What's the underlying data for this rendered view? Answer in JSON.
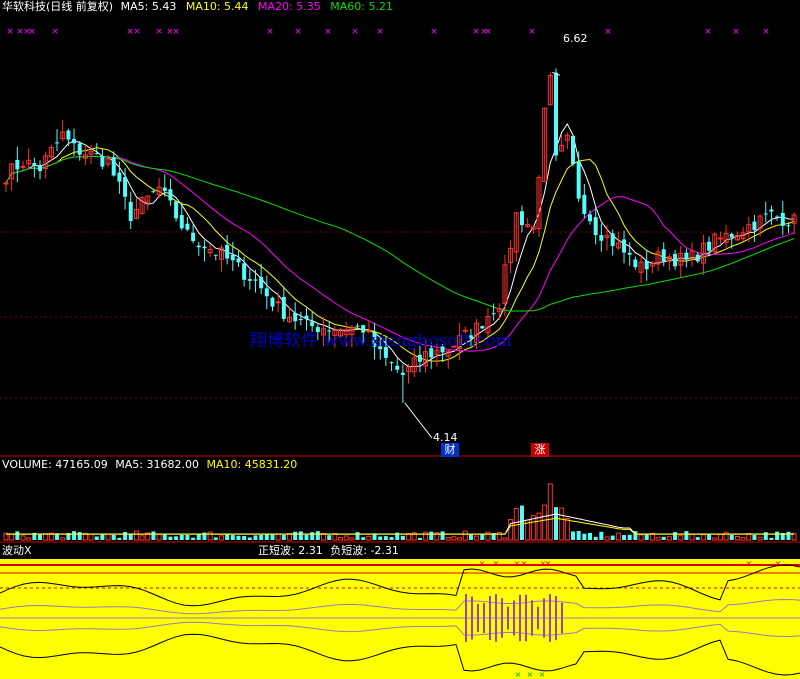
{
  "header": {
    "name": "华软科技(日线 前复权)",
    "ma5_label": "MA5:",
    "ma5_value": "5.43",
    "ma10_label": "MA10:",
    "ma10_value": "5.44",
    "ma20_label": "MA20:",
    "ma20_value": "5.35",
    "ma60_label": "MA60:",
    "ma60_value": "5.21"
  },
  "annotations": {
    "high": "6.62",
    "low": "4.14",
    "badge_cai": "财",
    "badge_zhang": "涨",
    "watermark": "翔博软件 www.xiangbosoft.com"
  },
  "volume_header": {
    "label": "VOLUME:",
    "value": "47165.09",
    "ma5_label": "MA5:",
    "ma5_value": "31682.00",
    "ma10_label": "MA10:",
    "ma10_value": "45831.20"
  },
  "indicator_header": {
    "name": "波动X",
    "pos_label": "正短波:",
    "pos_value": "2.31",
    "neg_label": "负短波:",
    "neg_value": "-2.31"
  },
  "colors": {
    "up": "#ff3232",
    "down": "#54fcfc",
    "ma5": "#ffffff",
    "ma10": "#ffff00",
    "ma20": "#ff00ff",
    "ma60": "#00e000",
    "marker": "#ff00ff",
    "osc_bg": "#ffff00",
    "watermark": "#0000c8"
  },
  "chart_data": {
    "type": "candlestick",
    "price_range": [
      3.9,
      6.9
    ],
    "low_point": 4.14,
    "high_point": 6.62,
    "anchors": [
      [
        0,
        5.85
      ],
      [
        3,
        5.95
      ],
      [
        6,
        5.9
      ],
      [
        10,
        6.15
      ],
      [
        12,
        6.05
      ],
      [
        18,
        5.95
      ],
      [
        22,
        5.55
      ],
      [
        27,
        5.75
      ],
      [
        32,
        5.4
      ],
      [
        38,
        5.25
      ],
      [
        44,
        5.05
      ],
      [
        48,
        4.85
      ],
      [
        53,
        4.72
      ],
      [
        58,
        4.7
      ],
      [
        63,
        4.7
      ],
      [
        66,
        4.5
      ],
      [
        70,
        4.35
      ],
      [
        74,
        4.5
      ],
      [
        78,
        4.55
      ],
      [
        83,
        4.7
      ],
      [
        87,
        4.9
      ],
      [
        90,
        5.55
      ],
      [
        93,
        5.45
      ],
      [
        95,
        6.3
      ],
      [
        96,
        6.55
      ],
      [
        97,
        5.95
      ],
      [
        99,
        6.1
      ],
      [
        101,
        5.7
      ],
      [
        104,
        5.45
      ],
      [
        107,
        5.35
      ],
      [
        112,
        5.15
      ],
      [
        116,
        5.25
      ],
      [
        120,
        5.2
      ],
      [
        125,
        5.35
      ],
      [
        130,
        5.45
      ],
      [
        135,
        5.55
      ],
      [
        139,
        5.5
      ]
    ],
    "ma_periods": [
      5,
      10,
      20,
      60
    ]
  }
}
